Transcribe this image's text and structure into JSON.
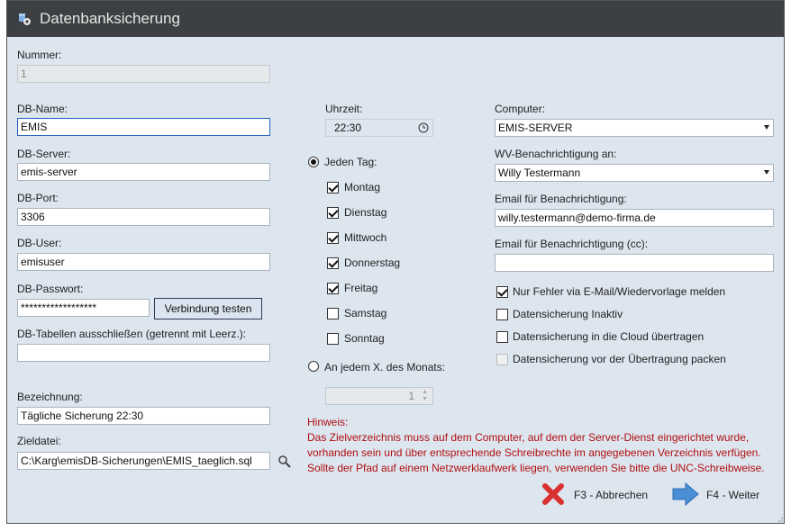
{
  "window": {
    "title": "Datenbanksicherung"
  },
  "form": {
    "nummer": {
      "label": "Nummer:",
      "value": "1"
    },
    "db_name": {
      "label": "DB-Name:",
      "value": "EMIS"
    },
    "db_server": {
      "label": "DB-Server:",
      "value": "emis-server"
    },
    "db_port": {
      "label": "DB-Port:",
      "value": "3306"
    },
    "db_user": {
      "label": "DB-User:",
      "value": "emisuser"
    },
    "db_passwort": {
      "label": "DB-Passwort:",
      "value": "******************"
    },
    "test_button": "Verbindung testen",
    "exclude_tables": {
      "label": "DB-Tabellen ausschließen (getrennt mit Leerz.):",
      "value": ""
    },
    "bezeichnung": {
      "label": "Bezeichnung:",
      "value": "Tägliche Sicherung 22:30"
    },
    "zieldatei": {
      "label": "Zieldatei:",
      "value": "C:\\Karg\\emisDB-Sicherungen\\EMIS_taeglich.sql"
    }
  },
  "schedule": {
    "uhrzeit_label": "Uhrzeit:",
    "uhrzeit_value": "22:30",
    "every_day_label": "Jeden Tag:",
    "days": [
      {
        "label": "Montag",
        "checked": true
      },
      {
        "label": "Dienstag",
        "checked": true
      },
      {
        "label": "Mittwoch",
        "checked": true
      },
      {
        "label": "Donnerstag",
        "checked": true
      },
      {
        "label": "Freitag",
        "checked": true
      },
      {
        "label": "Samstag",
        "checked": false
      },
      {
        "label": "Sonntag",
        "checked": false
      }
    ],
    "monthly_label": "An jedem X. des Monats:",
    "monthly_value": "1"
  },
  "right": {
    "computer_label": "Computer:",
    "computer_value": "EMIS-SERVER",
    "wv_label": "WV-Benachrichtigung an:",
    "wv_value": "Willy Testermann",
    "email_label": "Email für Benachrichtigung:",
    "email_value": "willy.testermann@demo-firma.de",
    "email_cc_label": "Email für Benachrichtigung (cc):",
    "email_cc_value": "",
    "options": [
      {
        "label": "Nur Fehler via E-Mail/Wiedervorlage melden",
        "checked": true,
        "disabled": false
      },
      {
        "label": "Datensicherung Inaktiv",
        "checked": false,
        "disabled": false
      },
      {
        "label": "Datensicherung in die Cloud übertragen",
        "checked": false,
        "disabled": false
      },
      {
        "label": "Datensicherung vor der Übertragung packen",
        "checked": false,
        "disabled": true
      }
    ]
  },
  "hint": {
    "title": "Hinweis:",
    "lines": [
      "Das Zielverzeichnis muss auf dem Computer, auf dem der Server-Dienst eingerichtet wurde,",
      "vorhanden sein und über entsprechende Schreibrechte im angegebenen Verzeichnis verfügen.",
      "Sollte der Pfad auf einem Netzwerklaufwerk liegen, verwenden Sie bitte die UNC-Schreibweise."
    ]
  },
  "footer": {
    "cancel": "F3 - Abbrechen",
    "next": "F4 - Weiter"
  },
  "colors": {
    "titlebar": "#3d4042",
    "content_bg": "#dde5ef",
    "hint": "#b01010",
    "cancel_icon": "#d93030",
    "next_icon": "#4a8fd6"
  }
}
